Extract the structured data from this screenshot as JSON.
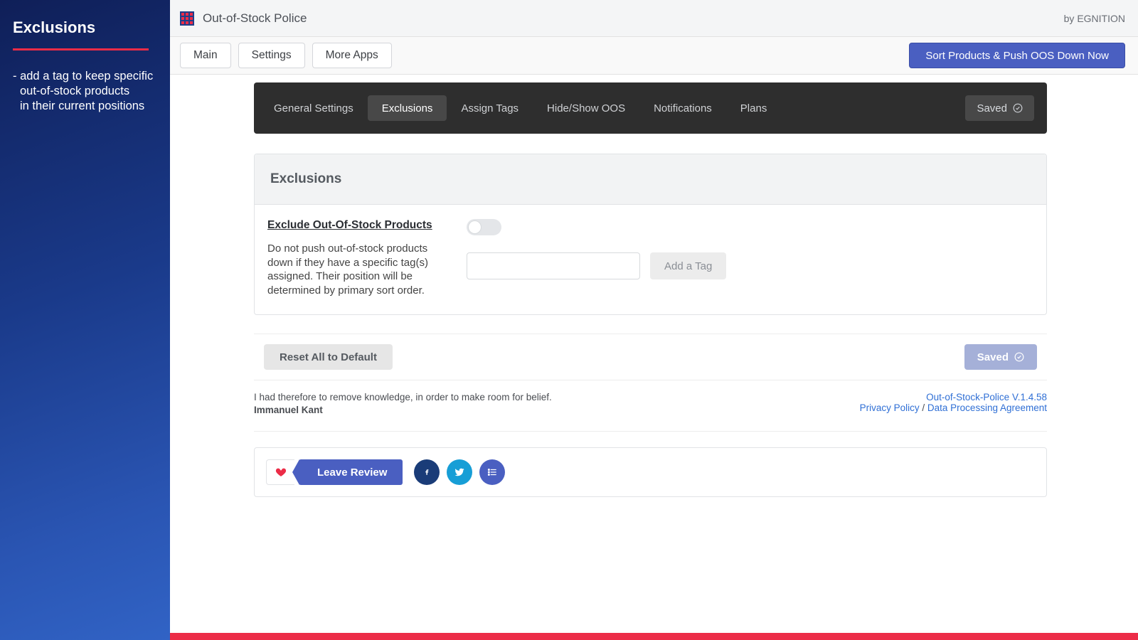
{
  "sidebar": {
    "title": "Exclusions",
    "desc_line1": "- add a tag to keep specific",
    "desc_line2": "out-of-stock products",
    "desc_line3": "in their current positions"
  },
  "topbar": {
    "app_title": "Out-of-Stock Police",
    "byline": "by EGNITION"
  },
  "nav": {
    "main": "Main",
    "settings": "Settings",
    "more_apps": "More Apps",
    "cta": "Sort Products & Push OOS Down Now"
  },
  "tabs": {
    "general": "General Settings",
    "exclusions": "Exclusions",
    "assign_tags": "Assign Tags",
    "hide_show": "Hide/Show OOS",
    "notifications": "Notifications",
    "plans": "Plans",
    "saved": "Saved",
    "active": "exclusions"
  },
  "card": {
    "header": "Exclusions",
    "setting_title": "Exclude Out-Of-Stock Products",
    "setting_desc": "Do not push out-of-stock products down if they have a specific tag(s) assigned. Their position will be determined by primary sort order.",
    "toggle_on": false,
    "tag_input_value": "",
    "add_tag": "Add a Tag"
  },
  "actions": {
    "reset": "Reset All to Default",
    "saved": "Saved"
  },
  "footer": {
    "quote": "I had therefore to remove knowledge, in order to make room for belief.",
    "author": "Immanuel Kant",
    "version": "Out-of-Stock-Police V.1.4.58",
    "privacy": "Privacy Policy",
    "sep": " / ",
    "dpa": "Data Processing Agreement"
  },
  "social": {
    "review": "Leave Review"
  }
}
